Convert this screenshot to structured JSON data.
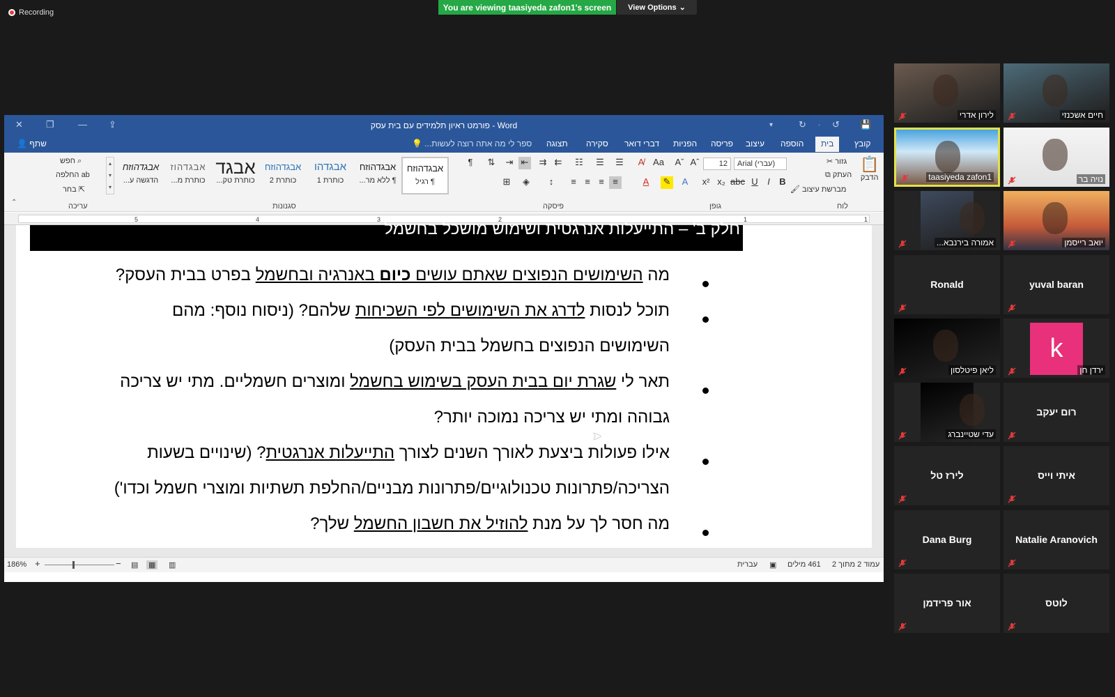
{
  "zoom": {
    "recording_label": "Recording",
    "viewing_banner": "You are viewing taasiyeda zafon1's screen",
    "view_options_label": "View Options"
  },
  "word": {
    "window_title": "פורמט ראיון תלמידים עם בית עסק - Word",
    "tabs": [
      "קובץ",
      "בית",
      "הוספה",
      "עיצוב",
      "פריסה",
      "הפניות",
      "דברי דואר",
      "סקירה",
      "תצוגה"
    ],
    "tell_me": "ספר לי מה אתה רוצה לעשות...",
    "share": "שתף",
    "ribbon": {
      "clipboard": {
        "label": "לוח",
        "paste": "הדבק",
        "cut": "גזור",
        "copy": "העתק",
        "format_painter": "מברשת עיצוב"
      },
      "font": {
        "label": "גופן",
        "font_name": "Arial (עברי)",
        "font_size": "12"
      },
      "paragraph": {
        "label": "פיסקה"
      },
      "styles": {
        "label": "סגנונות",
        "items": [
          {
            "sample": "אבגדהוזח",
            "name": "¶ רגיל"
          },
          {
            "sample": "אבגדהוזח",
            "name": "¶ ללא מר..."
          },
          {
            "sample": "אבגדהו",
            "name": "כותרת 1"
          },
          {
            "sample": "אבגדהוזח",
            "name": "כותרת 2"
          },
          {
            "sample": "אבגד",
            "name": "כותרת טק..."
          },
          {
            "sample": "אבגדהוז",
            "name": "כותרת מ..."
          },
          {
            "sample": "אבגדהוזח",
            "name": "הדגשה ע..."
          }
        ]
      },
      "editing": {
        "label": "עריכה",
        "find": "חפש",
        "replace": "החלפה",
        "select": "בחר"
      }
    },
    "ruler_numbers": [
      "1",
      "2",
      "3",
      "4",
      "5"
    ],
    "document": {
      "heading": "חלק ב' – התייעלות אנרגטית ושימוש מושכל בחשמל",
      "bullets": [
        {
          "lines": [
            [
              {
                "t": "מה "
              },
              {
                "t": "השימושים הנפוצים שאתם עושים ",
                "u": true
              },
              {
                "t": "כיום",
                "u": true,
                "b": true
              },
              {
                "t": " באנרגיה ובחשמל",
                "u": true
              },
              {
                "t": " בפרט בבית העסק?"
              }
            ]
          ]
        },
        {
          "lines": [
            [
              {
                "t": "תוכל לנסות "
              },
              {
                "t": "לדרג את השימושים לפי השכיחות",
                "u": true
              },
              {
                "t": " שלהם? (ניסוח נוסף: מהם"
              }
            ],
            [
              {
                "t": "השימושים הנפוצים בחשמל בבית העסק)"
              }
            ]
          ]
        },
        {
          "lines": [
            [
              {
                "t": "תאר לי "
              },
              {
                "t": "שגרת יום בבית העסק בשימוש בחשמל",
                "u": true
              },
              {
                "t": " ומוצרים חשמליים. מתי יש צריכה"
              }
            ],
            [
              {
                "t": "גבוהה ומתי יש צריכה נמוכה יותר?"
              }
            ]
          ]
        },
        {
          "lines": [
            [
              {
                "t": "אילו פעולות ביצעת לאורך השנים לצורך "
              },
              {
                "t": "התייעלות אנרגטית",
                "u": true
              },
              {
                "t": "? (שינויים בשעות"
              }
            ],
            [
              {
                "t": "הצריכה/פתרונות טכנולוגיים/פתרונות מבניים/החלפת תשתיות ומוצרי חשמל וכדו')"
              }
            ]
          ]
        },
        {
          "lines": [
            [
              {
                "t": "מה חסר לך על מנת "
              },
              {
                "t": "להוזיל את חשבון החשמל",
                "u": true
              },
              {
                "t": " שלך?"
              }
            ]
          ]
        }
      ]
    },
    "status": {
      "page": "עמוד 2 מתוך 2",
      "words": "461 מילים",
      "language": "עברית",
      "zoom": "186%"
    }
  },
  "participants": [
    {
      "name": "לירון אדרי",
      "video": true
    },
    {
      "name": "חיים אשכנזי",
      "video": true
    },
    {
      "name": "taasiyeda zafon1",
      "video": true,
      "active": true
    },
    {
      "name": "נויה בר",
      "video": true
    },
    {
      "name": "אמורה בירנבא...",
      "video": true
    },
    {
      "name": "יואב רייסמן",
      "video": true
    },
    {
      "name": "Ronald",
      "video": false
    },
    {
      "name": "yuval baran",
      "video": false
    },
    {
      "name": "ליאן פיטלסון",
      "video": true
    },
    {
      "name": "ירדן חן",
      "video": false,
      "avatar_letter": "k",
      "avatar_color": "#e8317a"
    },
    {
      "name": "עדי שטיינברג",
      "video": true
    },
    {
      "name": "רום יעקב",
      "video": false
    },
    {
      "name": "לירז טל",
      "video": false
    },
    {
      "name": "איתי וייס",
      "video": false
    },
    {
      "name": "Dana Burg",
      "video": false
    },
    {
      "name": "Natalie Aranovich",
      "video": false
    },
    {
      "name": "אור פרידמן",
      "video": false
    },
    {
      "name": "לוטס",
      "video": false
    }
  ],
  "colors": {
    "word_blue": "#2b579a",
    "zoom_green": "#25a845",
    "active_border": "#e1e24a",
    "mic_muted": "#e03b3b"
  }
}
